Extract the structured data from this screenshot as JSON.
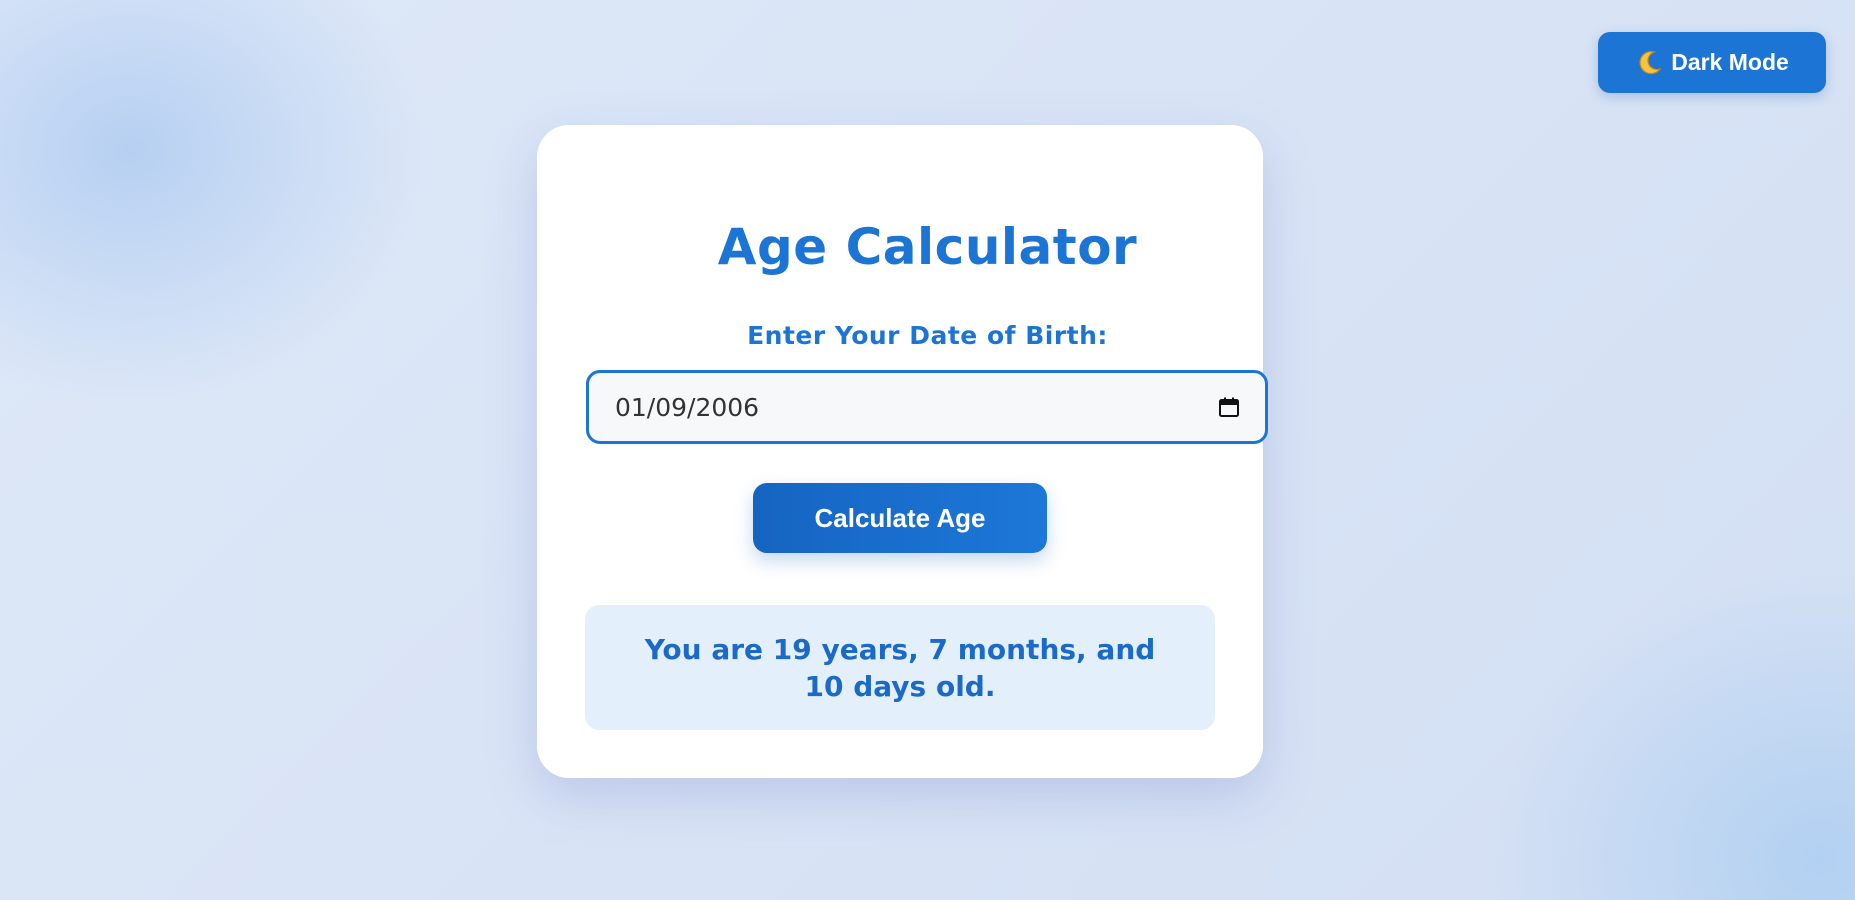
{
  "theme_toggle": {
    "icon": "moon-icon",
    "label": "Dark Mode"
  },
  "calculator": {
    "title": "Age Calculator",
    "dob_label": "Enter Your Date of Birth:",
    "dob_value": "01/09/2006",
    "dob_icon": "calendar-icon",
    "calculate_label": "Calculate Age",
    "result": "You are 19 years, 7 months, and 10 days old."
  },
  "colors": {
    "accent": "#1c74d4",
    "result_background": "#e3f0fc",
    "card_background": "#ffffff"
  }
}
